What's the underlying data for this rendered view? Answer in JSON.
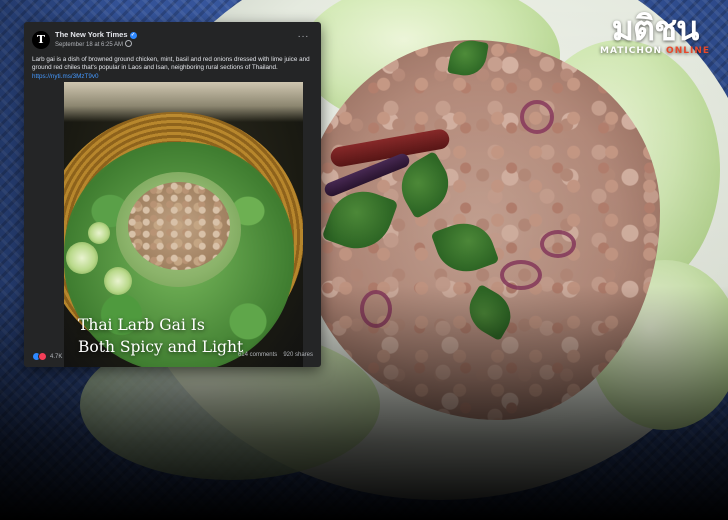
{
  "watermark": {
    "logo_text": "มติชน",
    "sub_primary": "MATICHON",
    "sub_secondary": "ONLINE"
  },
  "post": {
    "page_name": "The New York Times",
    "avatar_letter": "T",
    "date": "September 18 at 6:25 AM",
    "verified_mark": "✓",
    "more_icon": "···",
    "body": "Larb gai is a dish of browned ground chicken, mint, basil and red onions dressed with lime juice and ground red chiles that's popular in Laos and Isan, neighboring rural sections of Thailand.",
    "link": "https://nyti.ms/3MzT9v0",
    "image": {
      "caption_line1": "Thai Larb Gai Is",
      "caption_line2": "Both Spicy and Light"
    },
    "reactions": "4.7K",
    "comments": "614 comments",
    "shares": "920 shares"
  },
  "colors": {
    "card_bg": "#242526",
    "link": "#4599ff",
    "like": "#2d88ff",
    "love": "#f33e58",
    "brand_accent": "#e7492c"
  }
}
